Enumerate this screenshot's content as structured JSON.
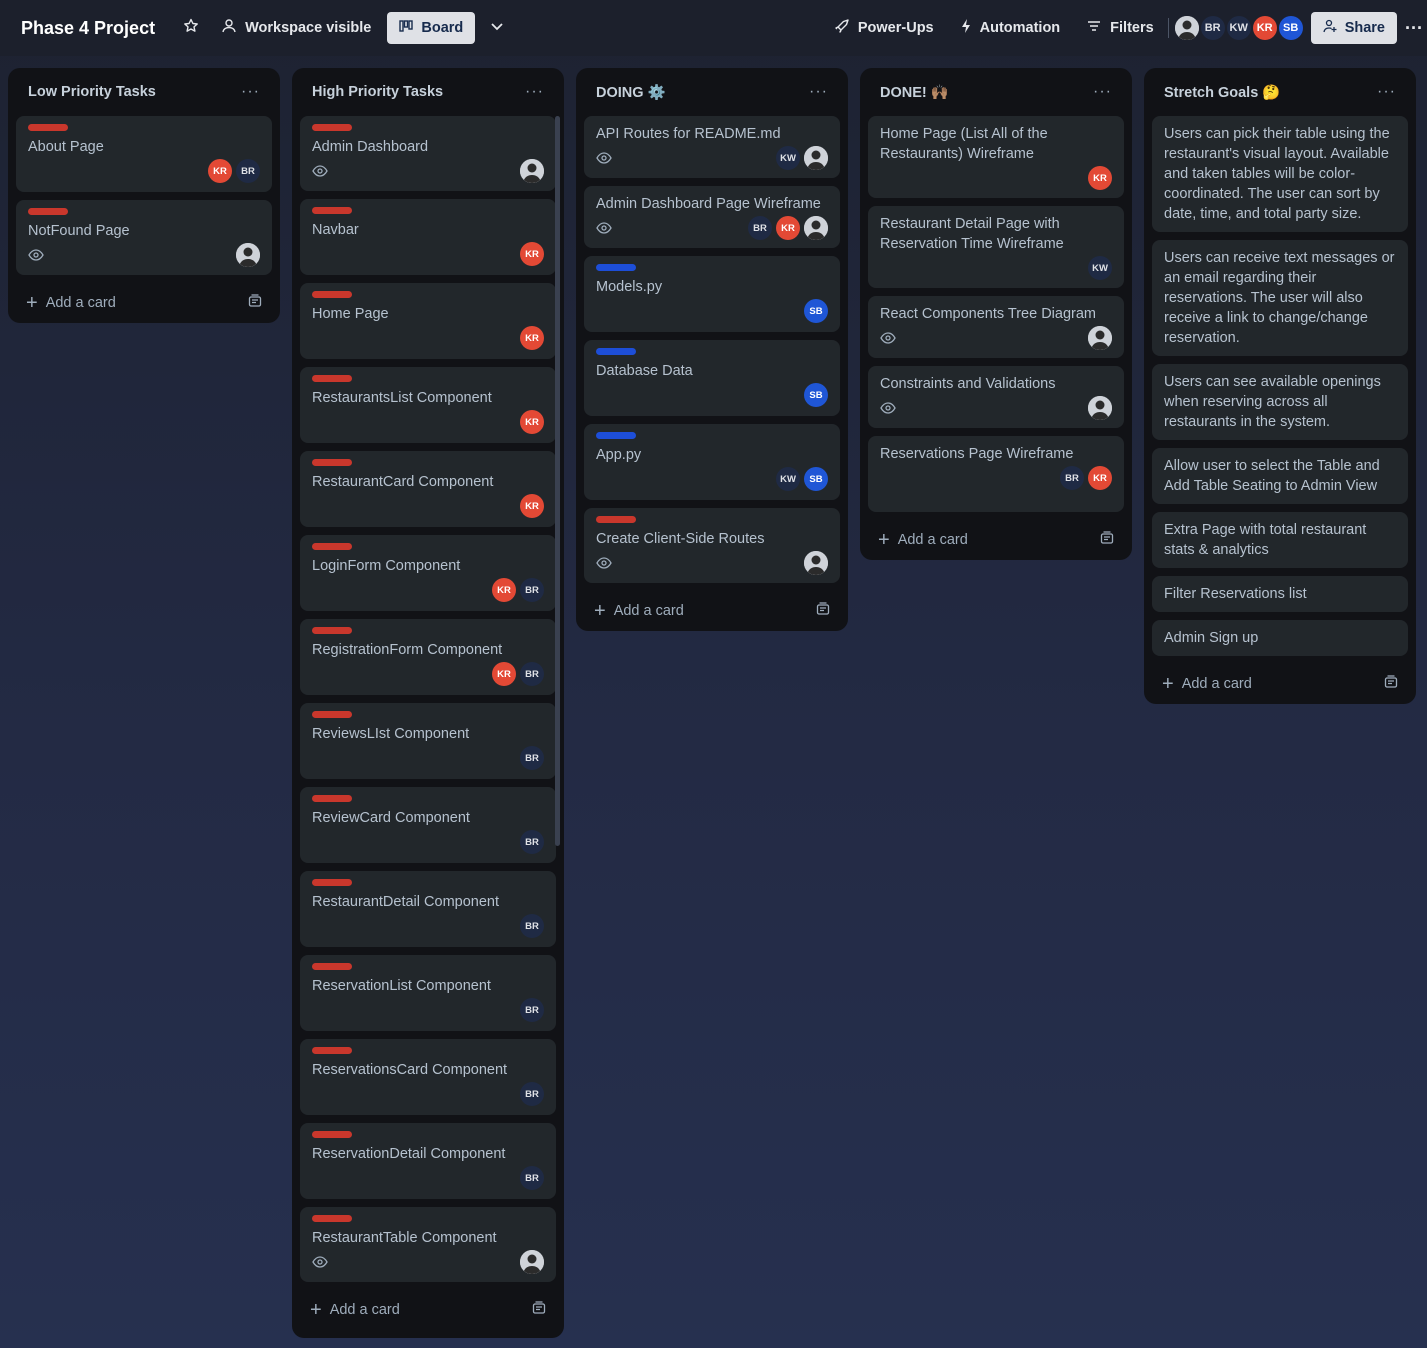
{
  "header": {
    "title": "Phase 4 Project",
    "visibility": "Workspace visible",
    "view": "Board",
    "powerups": "Power-Ups",
    "automation": "Automation",
    "filters": "Filters",
    "members": [
      "BR",
      "KW",
      "KR",
      "SB"
    ],
    "share": "Share"
  },
  "colors": {
    "red_label": "#c9372c",
    "blue_label": "#1d4ed8",
    "kr": "#e34935",
    "sb": "#1f56d6"
  },
  "add_card": "Add a card",
  "lists": [
    {
      "title": "Low Priority Tasks",
      "cards": [
        {
          "title": "About Page",
          "label": "red",
          "watch": false,
          "members": [
            "KR",
            "BR"
          ]
        },
        {
          "title": "NotFound Page",
          "label": "red",
          "watch": true,
          "members": [
            "photo"
          ]
        }
      ]
    },
    {
      "title": "High Priority Tasks",
      "cards": [
        {
          "title": "Admin Dashboard",
          "label": "red",
          "watch": true,
          "members": [
            "photo"
          ]
        },
        {
          "title": "Navbar",
          "label": "red",
          "watch": false,
          "members": [
            "KR"
          ]
        },
        {
          "title": "Home Page",
          "label": "red",
          "watch": false,
          "members": [
            "KR"
          ]
        },
        {
          "title": "RestaurantsList Component",
          "label": "red",
          "watch": false,
          "members": [
            "KR"
          ]
        },
        {
          "title": "RestaurantCard Component",
          "label": "red",
          "watch": false,
          "members": [
            "KR"
          ]
        },
        {
          "title": "LoginForm Component",
          "label": "red",
          "watch": false,
          "members": [
            "KR",
            "BR"
          ]
        },
        {
          "title": "RegistrationForm Component",
          "label": "red",
          "watch": false,
          "members": [
            "KR",
            "BR"
          ]
        },
        {
          "title": "ReviewsLIst Component",
          "label": "red",
          "watch": false,
          "members": [
            "BR"
          ]
        },
        {
          "title": "ReviewCard Component",
          "label": "red",
          "watch": false,
          "members": [
            "BR"
          ]
        },
        {
          "title": "RestaurantDetail Component",
          "label": "red",
          "watch": false,
          "members": [
            "BR"
          ]
        },
        {
          "title": "ReservationList Component",
          "label": "red",
          "watch": false,
          "members": [
            "BR"
          ]
        },
        {
          "title": "ReservationsCard Component",
          "label": "red",
          "watch": false,
          "members": [
            "BR"
          ]
        },
        {
          "title": "ReservationDetail Component",
          "label": "red",
          "watch": false,
          "members": [
            "BR"
          ]
        },
        {
          "title": "RestaurantTable Component",
          "label": "red",
          "watch": true,
          "members": [
            "photo"
          ]
        }
      ]
    },
    {
      "title": "DOING ⚙️",
      "cards": [
        {
          "title": "API Routes for README.md",
          "label": "",
          "watch": true,
          "members": [
            "KW",
            "photo"
          ]
        },
        {
          "title": "Admin Dashboard Page Wireframe",
          "label": "",
          "watch": true,
          "members": [
            "BR",
            "KR",
            "photo"
          ]
        },
        {
          "title": "Models.py",
          "label": "blue",
          "watch": false,
          "members": [
            "SB"
          ]
        },
        {
          "title": "Database Data",
          "label": "blue",
          "watch": false,
          "members": [
            "SB"
          ]
        },
        {
          "title": "App.py",
          "label": "blue",
          "watch": false,
          "members": [
            "KW",
            "SB"
          ]
        },
        {
          "title": "Create Client-Side Routes",
          "label": "red",
          "watch": true,
          "members": [
            "photo"
          ]
        }
      ]
    },
    {
      "title": "DONE! 🙌🏽",
      "cards": [
        {
          "title": "Home Page (List All of the Restaurants) Wireframe",
          "label": "",
          "watch": false,
          "members": [
            "KR"
          ]
        },
        {
          "title": "Restaurant Detail Page with Reservation Time Wireframe",
          "label": "",
          "watch": false,
          "members": [
            "KW"
          ]
        },
        {
          "title": "React Components Tree Diagram",
          "label": "",
          "watch": true,
          "members": [
            "photo"
          ]
        },
        {
          "title": "Constraints and Validations",
          "label": "",
          "watch": true,
          "members": [
            "photo"
          ]
        },
        {
          "title": "Reservations Page Wireframe",
          "label": "",
          "watch": false,
          "members": [
            "BR",
            "KR"
          ]
        }
      ]
    },
    {
      "title": "Stretch Goals 🤔",
      "cards": [
        {
          "title": "Users can pick their table using the restaurant's visual layout. Available and taken tables will be color-coordinated. The user can sort by date, time, and total party size.",
          "label": "",
          "watch": false,
          "members": []
        },
        {
          "title": "Users can receive text messages or an email regarding their reservations. The user will also receive a link to change/change reservation.",
          "label": "",
          "watch": false,
          "members": []
        },
        {
          "title": "Users can see available openings when reserving across all restaurants in the system.",
          "label": "",
          "watch": false,
          "members": []
        },
        {
          "title": "Allow user to select the Table and Add Table Seating to Admin View",
          "label": "",
          "watch": false,
          "members": []
        },
        {
          "title": "Extra Page with total restaurant stats & analytics",
          "label": "",
          "watch": false,
          "members": []
        },
        {
          "title": "Filter Reservations list",
          "label": "",
          "watch": false,
          "members": []
        },
        {
          "title": "Admin Sign up",
          "label": "",
          "watch": false,
          "members": []
        }
      ]
    }
  ]
}
